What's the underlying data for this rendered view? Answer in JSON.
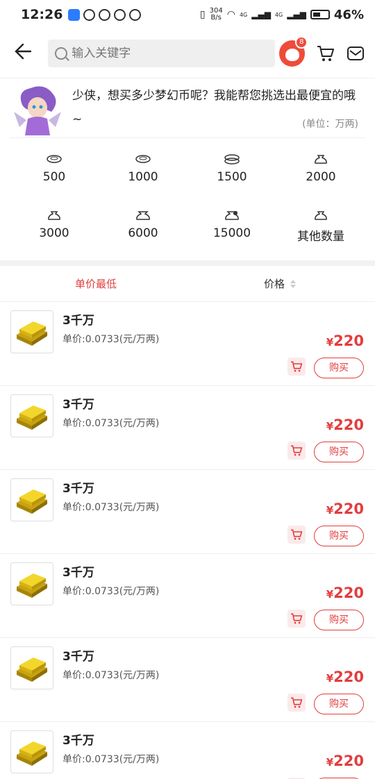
{
  "status_bar": {
    "time": "12:26",
    "net_speed_value": "304",
    "net_speed_unit": "B/s",
    "network_1": "4G",
    "network_2": "4G",
    "battery": "46%"
  },
  "header": {
    "search_placeholder": "输入关键字",
    "avatar_badge": "8"
  },
  "intro": {
    "message": "少侠，想买多少梦幻币呢？我能帮您挑选出最便宜的哦~",
    "unit": "(单位：万两)"
  },
  "amounts": [
    "500",
    "1000",
    "1500",
    "2000",
    "3000",
    "6000",
    "15000",
    "其他数量"
  ],
  "sort": {
    "lowest_unit_price": "单价最低",
    "price": "价格"
  },
  "listings": [
    {
      "title": "3千万",
      "unit_price": "单价:0.0733(元/万两)",
      "currency": "¥",
      "price": "220",
      "buy": "购买"
    },
    {
      "title": "3千万",
      "unit_price": "单价:0.0733(元/万两)",
      "currency": "¥",
      "price": "220",
      "buy": "购买"
    },
    {
      "title": "3千万",
      "unit_price": "单价:0.0733(元/万两)",
      "currency": "¥",
      "price": "220",
      "buy": "购买"
    },
    {
      "title": "3千万",
      "unit_price": "单价:0.0733(元/万两)",
      "currency": "¥",
      "price": "220",
      "buy": "购买"
    },
    {
      "title": "3千万",
      "unit_price": "单价:0.0733(元/万两)",
      "currency": "¥",
      "price": "220",
      "buy": "购买"
    },
    {
      "title": "3千万",
      "unit_price": "单价:0.0733(元/万两)",
      "currency": "¥",
      "price": "220",
      "buy": "购买"
    }
  ],
  "colors": {
    "accent": "#e23d3d",
    "gold": "#f3d62b"
  }
}
